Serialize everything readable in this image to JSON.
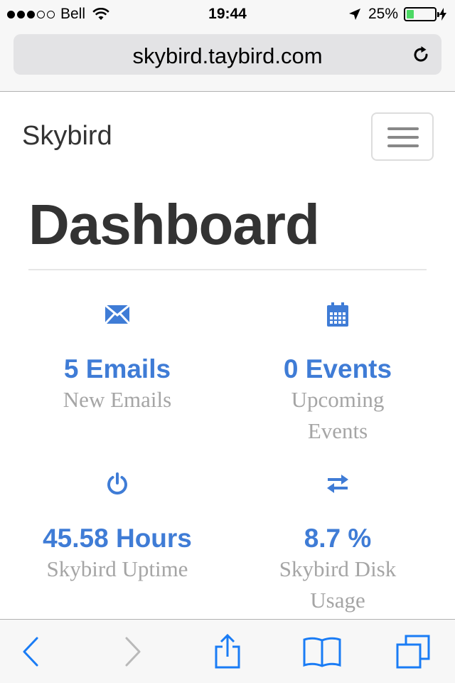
{
  "status_bar": {
    "carrier": "Bell",
    "time": "19:44",
    "battery_percent_text": "25%",
    "battery_level": 0.25,
    "signal_bars_filled": 3,
    "signal_bars_total": 5
  },
  "url_bar": {
    "url": "skybird.taybird.com"
  },
  "navbar": {
    "brand": "Skybird"
  },
  "page": {
    "title": "Dashboard"
  },
  "stats": [
    {
      "icon": "envelope-icon",
      "value": "5 Emails",
      "label": "New Emails"
    },
    {
      "icon": "calendar-icon",
      "value": "0 Events",
      "label": "Upcoming Events"
    },
    {
      "icon": "power-icon",
      "value": "45.58 Hours",
      "label": "Skybird Uptime"
    },
    {
      "icon": "transfer-icon",
      "value": "8.7 %",
      "label": "Skybird Disk Usage"
    }
  ],
  "colors": {
    "accent": "#3f7cd6",
    "label_gray": "#a5a5a5",
    "ios_blue": "#1a7cf5",
    "battery_green": "#4cd964"
  }
}
